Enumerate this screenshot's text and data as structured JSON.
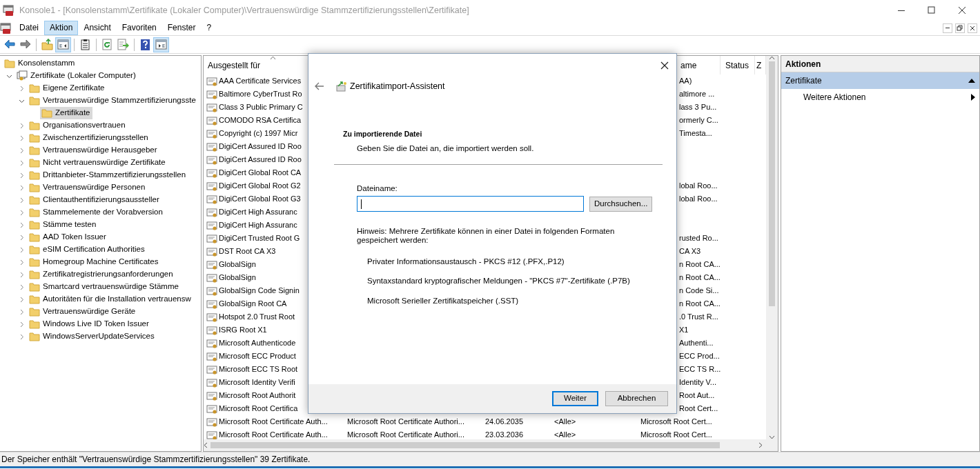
{
  "window": {
    "title": "Konsole1 - [Konsolenstamm\\Zertifikate (Lokaler Computer)\\Vertrauenswürdige Stammzertifizierungsstellen\\Zertifikate]"
  },
  "menu": [
    {
      "label": "Datei",
      "selected": false
    },
    {
      "label": "Aktion",
      "selected": true
    },
    {
      "label": "Ansicht",
      "selected": false
    },
    {
      "label": "Favoriten",
      "selected": false
    },
    {
      "label": "Fenster",
      "selected": false
    },
    {
      "label": "?",
      "selected": false
    }
  ],
  "toolbar_groups": [
    {
      "buttons": [
        {
          "kind": "back",
          "pressed": false
        },
        {
          "kind": "forward",
          "pressed": false
        }
      ]
    },
    {
      "buttons": [
        {
          "kind": "up",
          "pressed": false
        },
        {
          "kind": "tree",
          "pressed": true
        }
      ]
    },
    {
      "buttons": [
        {
          "kind": "clipboard",
          "pressed": false
        }
      ]
    },
    {
      "buttons": [
        {
          "kind": "refresh",
          "pressed": false
        },
        {
          "kind": "export",
          "pressed": false
        }
      ]
    },
    {
      "buttons": [
        {
          "kind": "help",
          "pressed": false
        },
        {
          "kind": "pane",
          "pressed": true
        }
      ]
    }
  ],
  "tree": [
    {
      "label": "Konsolenstamm",
      "kind": "folder",
      "selected": false,
      "children": [
        {
          "label": "Zertifikate (Lokaler Computer)",
          "kind": "store",
          "expanded": true,
          "selected": false,
          "children": [
            {
              "label": "Eigene Zertifikate",
              "kind": "folder",
              "expanded": false,
              "selected": false
            },
            {
              "label": "Vertrauenswürdige Stammzertifizierungsste",
              "kind": "folder",
              "expanded": true,
              "selected": false,
              "children": [
                {
                  "label": "Zertifikate",
                  "kind": "folder",
                  "selected": true
                }
              ]
            },
            {
              "label": "Organisationsvertrauen",
              "kind": "folder",
              "expanded": false,
              "selected": false
            },
            {
              "label": "Zwischenzertifizierungsstellen",
              "kind": "folder",
              "expanded": false,
              "selected": false
            },
            {
              "label": "Vertrauenswürdige Herausgeber",
              "kind": "folder",
              "expanded": false,
              "selected": false
            },
            {
              "label": "Nicht vertrauenswürdige Zertifikate",
              "kind": "folder",
              "expanded": false,
              "selected": false
            },
            {
              "label": "Drittanbieter-Stammzertifizierungsstellen",
              "kind": "folder",
              "expanded": false,
              "selected": false
            },
            {
              "label": "Vertrauenswürdige Personen",
              "kind": "folder",
              "expanded": false,
              "selected": false
            },
            {
              "label": "Clientauthentifizierungsaussteller",
              "kind": "folder",
              "expanded": false,
              "selected": false
            },
            {
              "label": "Stammelemente der Vorabversion",
              "kind": "folder",
              "expanded": false,
              "selected": false
            },
            {
              "label": "Stämme testen",
              "kind": "folder",
              "expanded": false,
              "selected": false
            },
            {
              "label": "AAD Token Issuer",
              "kind": "folder",
              "expanded": false,
              "selected": false
            },
            {
              "label": "eSIM Certification Authorities",
              "kind": "folder",
              "expanded": false,
              "selected": false
            },
            {
              "label": "Homegroup Machine Certificates",
              "kind": "folder",
              "expanded": false,
              "selected": false
            },
            {
              "label": "Zertifikatregistrierungsanforderungen",
              "kind": "folder",
              "expanded": false,
              "selected": false
            },
            {
              "label": "Smartcard vertrauenswürdige Stämme",
              "kind": "folder",
              "expanded": false,
              "selected": false
            },
            {
              "label": "Autoritäten für die Installation vertrauensw",
              "kind": "folder",
              "expanded": false,
              "selected": false
            },
            {
              "label": "Vertrauenswürdige Geräte",
              "kind": "folder",
              "expanded": false,
              "selected": false
            },
            {
              "label": "Windows Live ID Token Issuer",
              "kind": "folder",
              "expanded": false,
              "selected": false
            },
            {
              "label": "WindowsServerUpdateServices",
              "kind": "folder",
              "expanded": false,
              "selected": false
            }
          ]
        }
      ]
    }
  ],
  "table": {
    "columns": [
      {
        "label": "Ausgestellt für",
        "sorted": true,
        "kind": "left"
      },
      {
        "label": "ame",
        "kind": "name"
      },
      {
        "label": "Status",
        "kind": "status"
      },
      {
        "label": "Z",
        "kind": "last"
      }
    ],
    "rows": [
      {
        "kind": "covered",
        "issued_to": "AAA Certificate Services",
        "friendly_name": "AA)"
      },
      {
        "kind": "covered",
        "issued_to": "Baltimore CyberTrust Ro",
        "friendly_name": "altimore ..."
      },
      {
        "kind": "covered",
        "issued_to": "Class 3 Public Primary C",
        "friendly_name": "lass 3 Pu..."
      },
      {
        "kind": "covered",
        "issued_to": "COMODO RSA Certifica",
        "friendly_name": "ormerly C..."
      },
      {
        "kind": "covered",
        "issued_to": "Copyright (c) 1997 Micr",
        "friendly_name": "Timesta..."
      },
      {
        "kind": "covered",
        "issued_to": "DigiCert Assured ID Roo"
      },
      {
        "kind": "covered",
        "issued_to": "DigiCert Assured ID Roo"
      },
      {
        "kind": "covered",
        "issued_to": "DigiCert Global Root CA"
      },
      {
        "kind": "covered",
        "issued_to": "DigiCert Global Root G2",
        "friendly_name": "lobal Roo..."
      },
      {
        "kind": "covered",
        "issued_to": "DigiCert Global Root G3",
        "friendly_name": "lobal Roo..."
      },
      {
        "kind": "covered",
        "issued_to": "DigiCert High Assuranc"
      },
      {
        "kind": "covered",
        "issued_to": "DigiCert High Assuranc"
      },
      {
        "kind": "covered",
        "issued_to": "DigiCert Trusted Root G",
        "friendly_name": "rusted Ro..."
      },
      {
        "kind": "covered",
        "issued_to": "DST Root CA X3",
        "friendly_name": "CA X3"
      },
      {
        "kind": "covered",
        "issued_to": "GlobalSign",
        "friendly_name": "n Root CA..."
      },
      {
        "kind": "covered",
        "issued_to": "GlobalSign",
        "friendly_name": "n Root CA..."
      },
      {
        "kind": "covered",
        "issued_to": "GlobalSign Code Signin",
        "friendly_name": "n Code Si..."
      },
      {
        "kind": "covered",
        "issued_to": "GlobalSign Root CA",
        "friendly_name": "n Root CA..."
      },
      {
        "kind": "covered",
        "issued_to": "Hotspot 2.0 Trust Root",
        "friendly_name": ".0 Trust R..."
      },
      {
        "kind": "covered",
        "issued_to": "ISRG Root X1",
        "friendly_name": "X1"
      },
      {
        "kind": "covered",
        "issued_to": "Microsoft Authenticode",
        "friendly_name": "Authenti..."
      },
      {
        "kind": "covered",
        "issued_to": "Microsoft ECC Product",
        "friendly_name": "ECC Prod..."
      },
      {
        "kind": "covered",
        "issued_to": "Microsoft ECC TS Root",
        "friendly_name": "ECC TS R..."
      },
      {
        "kind": "covered",
        "issued_to": "Microsoft Identity Verifi",
        "friendly_name": "Identity V..."
      },
      {
        "kind": "covered",
        "issued_to": "Microsoft Root Authorit",
        "friendly_name": "Root Aut..."
      },
      {
        "kind": "covered",
        "issued_to": "Microsoft Root Certifica",
        "friendly_name": "Root Cert..."
      },
      {
        "kind": "full",
        "issued_to": "Microsoft Root Certificate Auth...",
        "issued_by": "Microsoft Root Certificate Authori...",
        "expires": "24.06.2035",
        "purposes": "<Alle>",
        "friendly_name": "Microsoft Root Cert..."
      },
      {
        "kind": "full",
        "issued_to": "Microsoft Root Certificate Auth...",
        "issued_by": "Microsoft Root Certificate Authori...",
        "expires": "23.03.2036",
        "purposes": "<Alle>",
        "friendly_name": "Microsoft Root Cert..."
      }
    ]
  },
  "actions": {
    "title": "Aktionen",
    "section": {
      "label": "Zertifikate",
      "expanded": true
    },
    "items": [
      {
        "label": "Weitere Aktionen"
      }
    ]
  },
  "status_bar": "Der Speicher enthält \"Vertrauenswürdige Stammzertifizierungsstellen\" 39 Zertifikate.",
  "dialog": {
    "title": "Zertifikatimport-Assistent",
    "section_title": "Zu importierende Datei",
    "section_subtitle": "Geben Sie die Datei an, die importiert werden soll.",
    "filename_label": "Dateiname:",
    "filename_field": {
      "focused": true
    },
    "browse_button": "Durchsuchen...",
    "hint": "Hinweis: Mehrere Zertifikate können in einer Datei in folgenden Formaten gespeichert werden:",
    "formats": [
      "Privater Informationsaustausch - PKCS #12 (.PFX,.P12)",
      "Syntaxstandard kryptografischer Meldungen - \"PKCS #7\"-Zertifikate (.P7B)",
      "Microsoft Serieller Zertifikatspeicher (.SST)"
    ],
    "buttons": [
      {
        "label": "Weiter",
        "default": true
      },
      {
        "label": "Abbrechen",
        "default": false
      }
    ]
  }
}
